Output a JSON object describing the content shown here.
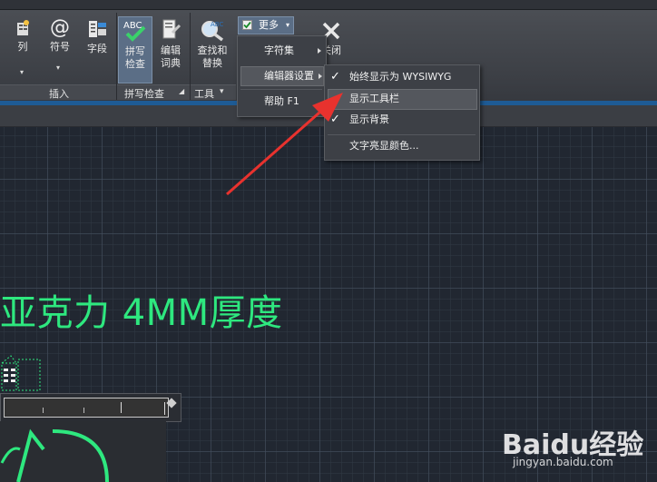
{
  "ribbon": {
    "buttons": {
      "column": "列",
      "symbol": "符号",
      "field": "字段",
      "spellcheck": "拼写\n检查",
      "edit_dict": "编辑\n词典",
      "find_replace": "查找和\n替换",
      "more": "更多",
      "close": "关闭"
    },
    "groups": {
      "insert": "插入",
      "spellcheck": "拼写检查",
      "tools": "工具"
    }
  },
  "more_menu": {
    "items": [
      "字符集",
      "编辑器设置",
      "帮助 F1"
    ]
  },
  "editor_settings_menu": {
    "items": [
      {
        "label": "始终显示为 WYSIWYG",
        "checked": true
      },
      {
        "label": "显示工具栏",
        "checked": false
      },
      {
        "label": "显示背景",
        "checked": true
      },
      {
        "label": "文字亮显颜色...",
        "checked": false
      }
    ]
  },
  "canvas": {
    "mtext": "亚克力 4MM厚度"
  },
  "watermark": {
    "brand": "Baidu经验",
    "url": "jingyan.baidu.com"
  },
  "colors": {
    "mtext": "#2ee87f",
    "arrow": "#e8322e",
    "highlight": "#54575d"
  }
}
